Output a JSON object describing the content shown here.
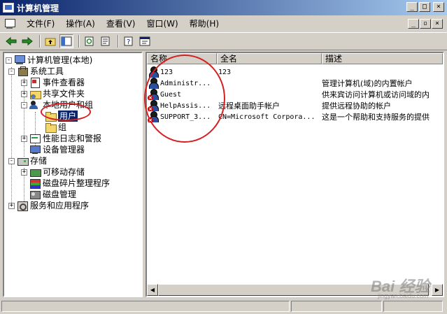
{
  "window": {
    "title": "计算机管理"
  },
  "menubar": {
    "items": [
      {
        "label": "文件(F)"
      },
      {
        "label": "操作(A)"
      },
      {
        "label": "查看(V)"
      },
      {
        "label": "窗口(W)"
      },
      {
        "label": "帮助(H)"
      }
    ]
  },
  "tree": {
    "items": [
      {
        "label": "计算机管理(本地)",
        "icon": "computer-icon"
      },
      {
        "label": "系统工具",
        "icon": "toolbox-icon"
      },
      {
        "label": "事件查看器",
        "icon": "event-viewer-icon"
      },
      {
        "label": "共享文件夹",
        "icon": "shared-folder-icon"
      },
      {
        "label": "本地用户和组",
        "icon": "users-group-icon"
      },
      {
        "label": "用户",
        "icon": "folder-icon",
        "selected": true
      },
      {
        "label": "组",
        "icon": "folder-icon"
      },
      {
        "label": "性能日志和警报",
        "icon": "performance-icon"
      },
      {
        "label": "设备管理器",
        "icon": "device-manager-icon"
      },
      {
        "label": "存储",
        "icon": "storage-icon"
      },
      {
        "label": "可移动存储",
        "icon": "removable-storage-icon"
      },
      {
        "label": "磁盘碎片整理程序",
        "icon": "defrag-icon"
      },
      {
        "label": "磁盘管理",
        "icon": "disk-management-icon"
      },
      {
        "label": "服务和应用程序",
        "icon": "services-icon"
      }
    ]
  },
  "list": {
    "columns": [
      "名称",
      "全名",
      "描述"
    ],
    "rows": [
      {
        "name": "123",
        "fullname": "123",
        "description": "",
        "disabled": false
      },
      {
        "name": "Administr...",
        "fullname": "",
        "description": "管理计算机(域)的内置帐户",
        "disabled": false
      },
      {
        "name": "Guest",
        "fullname": "",
        "description": "供来宾访问计算机或访问域的内",
        "disabled": true
      },
      {
        "name": "HelpAssis...",
        "fullname": "远程桌面助手帐户",
        "description": "提供远程协助的帐户",
        "disabled": true
      },
      {
        "name": "SUPPORT_3...",
        "fullname": "CN=Microsoft Corpora...",
        "description": "这是一个帮助和支持服务的提供",
        "disabled": true
      }
    ]
  },
  "watermark": {
    "brand": "Bai 经验",
    "url": "jingyan.baidu.com"
  },
  "colors": {
    "titlebar_start": "#0a246a",
    "titlebar_end": "#a6caf0",
    "annotation_circle": "#d42020",
    "selection": "#0a246a"
  }
}
